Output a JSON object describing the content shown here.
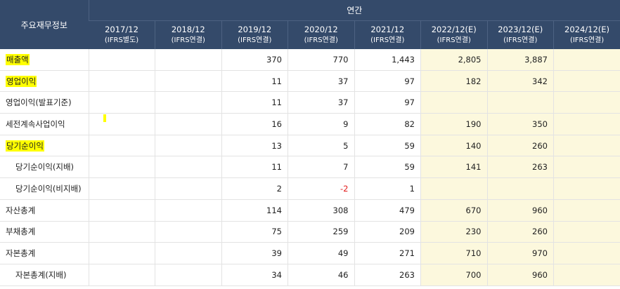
{
  "header": {
    "title": "주요재무정보",
    "period_group": "연간",
    "columns": [
      {
        "period": "2017/12",
        "basis": "(IFRS별도)",
        "estimate": false
      },
      {
        "period": "2018/12",
        "basis": "(IFRS연결)",
        "estimate": false
      },
      {
        "period": "2019/12",
        "basis": "(IFRS연결)",
        "estimate": false
      },
      {
        "period": "2020/12",
        "basis": "(IFRS연결)",
        "estimate": false
      },
      {
        "period": "2021/12",
        "basis": "(IFRS연결)",
        "estimate": false
      },
      {
        "period": "2022/12(E)",
        "basis": "(IFRS연결)",
        "estimate": true
      },
      {
        "period": "2023/12(E)",
        "basis": "(IFRS연결)",
        "estimate": true
      },
      {
        "period": "2024/12(E)",
        "basis": "(IFRS연결)",
        "estimate": true
      }
    ]
  },
  "rows": [
    {
      "label": "매출액",
      "highlight": true,
      "indent": false,
      "values": [
        "",
        "",
        "370",
        "770",
        "1,443",
        "2,805",
        "3,887",
        ""
      ]
    },
    {
      "label": "영업이익",
      "highlight": true,
      "indent": false,
      "values": [
        "",
        "",
        "11",
        "37",
        "97",
        "182",
        "342",
        ""
      ]
    },
    {
      "label": "영업이익(발표기준)",
      "highlight": false,
      "indent": false,
      "values": [
        "",
        "",
        "11",
        "37",
        "97",
        "",
        "",
        ""
      ]
    },
    {
      "label": "세전계속사업이익",
      "highlight": false,
      "indent": false,
      "values": [
        "",
        "",
        "16",
        "9",
        "82",
        "190",
        "350",
        ""
      ]
    },
    {
      "label": "당기순이익",
      "highlight": true,
      "indent": false,
      "values": [
        "",
        "",
        "13",
        "5",
        "59",
        "140",
        "260",
        ""
      ]
    },
    {
      "label": "당기순이익(지배)",
      "highlight": false,
      "indent": true,
      "values": [
        "",
        "",
        "11",
        "7",
        "59",
        "141",
        "263",
        ""
      ]
    },
    {
      "label": "당기순이익(비지배)",
      "highlight": false,
      "indent": true,
      "values": [
        "",
        "",
        "2",
        "-2",
        "1",
        "",
        "",
        ""
      ]
    },
    {
      "label": "자산총계",
      "highlight": false,
      "indent": false,
      "values": [
        "",
        "",
        "114",
        "308",
        "479",
        "670",
        "960",
        ""
      ]
    },
    {
      "label": "부채총계",
      "highlight": false,
      "indent": false,
      "values": [
        "",
        "",
        "75",
        "259",
        "209",
        "230",
        "260",
        ""
      ]
    },
    {
      "label": "자본총계",
      "highlight": false,
      "indent": false,
      "values": [
        "",
        "",
        "39",
        "49",
        "271",
        "710",
        "970",
        ""
      ]
    },
    {
      "label": "자본총계(지배)",
      "highlight": false,
      "indent": true,
      "values": [
        "",
        "",
        "34",
        "46",
        "263",
        "700",
        "960",
        ""
      ]
    }
  ],
  "colors": {
    "header_bg": "#344a6a",
    "estimate_bg": "#fcf8dd",
    "highlight": "#ffff00",
    "negative": "#e21d1d"
  }
}
